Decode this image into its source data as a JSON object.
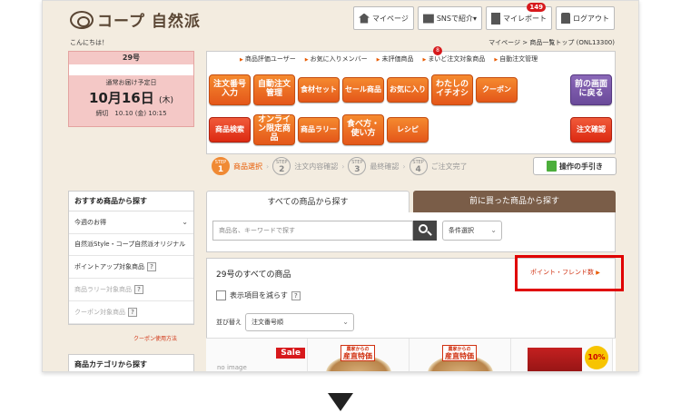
{
  "header": {
    "logo_text": "コープ 自然派",
    "buttons": [
      {
        "label": "マイページ",
        "icon": "home-icon"
      },
      {
        "label": "SNSで紹介▾",
        "icon": "mail-icon"
      },
      {
        "label": "マイレポート",
        "icon": "report-icon",
        "badge": "149"
      },
      {
        "label": "ログアウト",
        "icon": "lock-icon"
      }
    ]
  },
  "greeting": "こんにちは！",
  "breadcrumb": {
    "home": "マイページ",
    "sep": ">",
    "current": "商品一覧トップ (ONL13300)"
  },
  "delivery": {
    "issue": "29号",
    "label": "通常お届け予定日",
    "date": "10月16日",
    "weekday": "(木)",
    "deadline": "締切　10.10 (金) 10:15"
  },
  "menu_links": [
    "商品評価ユーザー",
    "お気に入りメンバー",
    "未評価商品",
    "まいど注文対象商品",
    "自動注文管理"
  ],
  "menu_badge": "8",
  "menu_buttons": {
    "b1": "注文番号入力",
    "b2": "自動注文管理",
    "b3": "食材セット",
    "b4": "セール商品",
    "b5": "お気に入り",
    "b6": "わたしのイチオシ",
    "b7": "クーポン",
    "b8": "前の画面に戻る",
    "b9": "商品検索",
    "b10": "オンライン限定商品",
    "b11": "商品ラリー",
    "b12": "食べ方・使い方",
    "b13": "レシピ",
    "b14": "注文確認"
  },
  "steps": [
    {
      "no": "1",
      "label": "商品選択"
    },
    {
      "no": "2",
      "label": "注文内容確認"
    },
    {
      "no": "3",
      "label": "最終確認"
    },
    {
      "no": "4",
      "label": "ご注文完了"
    }
  ],
  "step_word": "STEP",
  "guide_label": "操作の手引き",
  "sidebar": {
    "title": "おすすめ商品から探す",
    "items": [
      {
        "label": "今週のお得"
      },
      {
        "label": "自然派Style・コープ自然派オリジナル"
      },
      {
        "label": "ポイントアップ対象商品"
      },
      {
        "label": "商品ラリー対象商品"
      },
      {
        "label": "クーポン対象商品"
      }
    ],
    "coupon_link": "クーポン使用方法",
    "category_title": "商品カテゴリから探す"
  },
  "tabs": {
    "all": "すべての商品から探す",
    "past": "前に買った商品から探す"
  },
  "search": {
    "placeholder": "商品名、キーワードで探す",
    "condition": "条件選択"
  },
  "results": {
    "title": "29号のすべての商品",
    "point_link": "ポイント・フレンド数",
    "reduce_label": "表示項目を減らす",
    "sort_label": "並び替え",
    "sort_value": "注文番号順"
  },
  "products": {
    "sale": "Sale",
    "noimage": "no image",
    "tag_top": "農家からの",
    "tag_main": "産直特価",
    "pct": "10%"
  }
}
